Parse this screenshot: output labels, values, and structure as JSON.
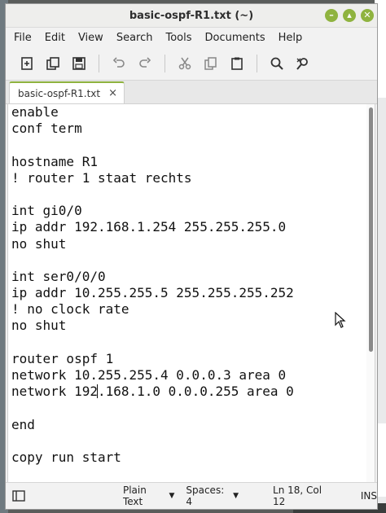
{
  "window": {
    "title": "basic-ospf-R1.txt (~)"
  },
  "menu": [
    "File",
    "Edit",
    "View",
    "Search",
    "Tools",
    "Documents",
    "Help"
  ],
  "toolbar": {
    "icons": [
      "new-document-icon",
      "new-window-icon",
      "save-icon",
      "undo-icon",
      "redo-icon",
      "cut-icon",
      "copy-icon",
      "paste-icon",
      "search-icon",
      "replace-icon"
    ]
  },
  "tab": {
    "label": "basic-ospf-R1.txt",
    "close": "×"
  },
  "editor": {
    "lines": [
      "enable",
      "conf term",
      "",
      "hostname R1",
      "! router 1 staat rechts",
      "",
      "int gi0/0",
      "ip addr 192.168.1.254 255.255.255.0",
      "no shut",
      "",
      "int ser0/0/0",
      "ip addr 10.255.255.5 255.255.255.252",
      "! no clock rate",
      "no shut",
      "",
      "router ospf 1",
      "network 10.255.255.4 0.0.0.3 area 0",
      "network 192.168.1.0 0.0.0.255 area 0",
      "",
      "end",
      "",
      "copy run start"
    ],
    "cursor_line": 17,
    "cursor_col": 12
  },
  "statusbar": {
    "language": "Plain Text",
    "spaces": "Spaces: 4",
    "position": "Ln 18, Col 12",
    "mode": "INS"
  },
  "colors": {
    "accent": "#8fb33f"
  }
}
